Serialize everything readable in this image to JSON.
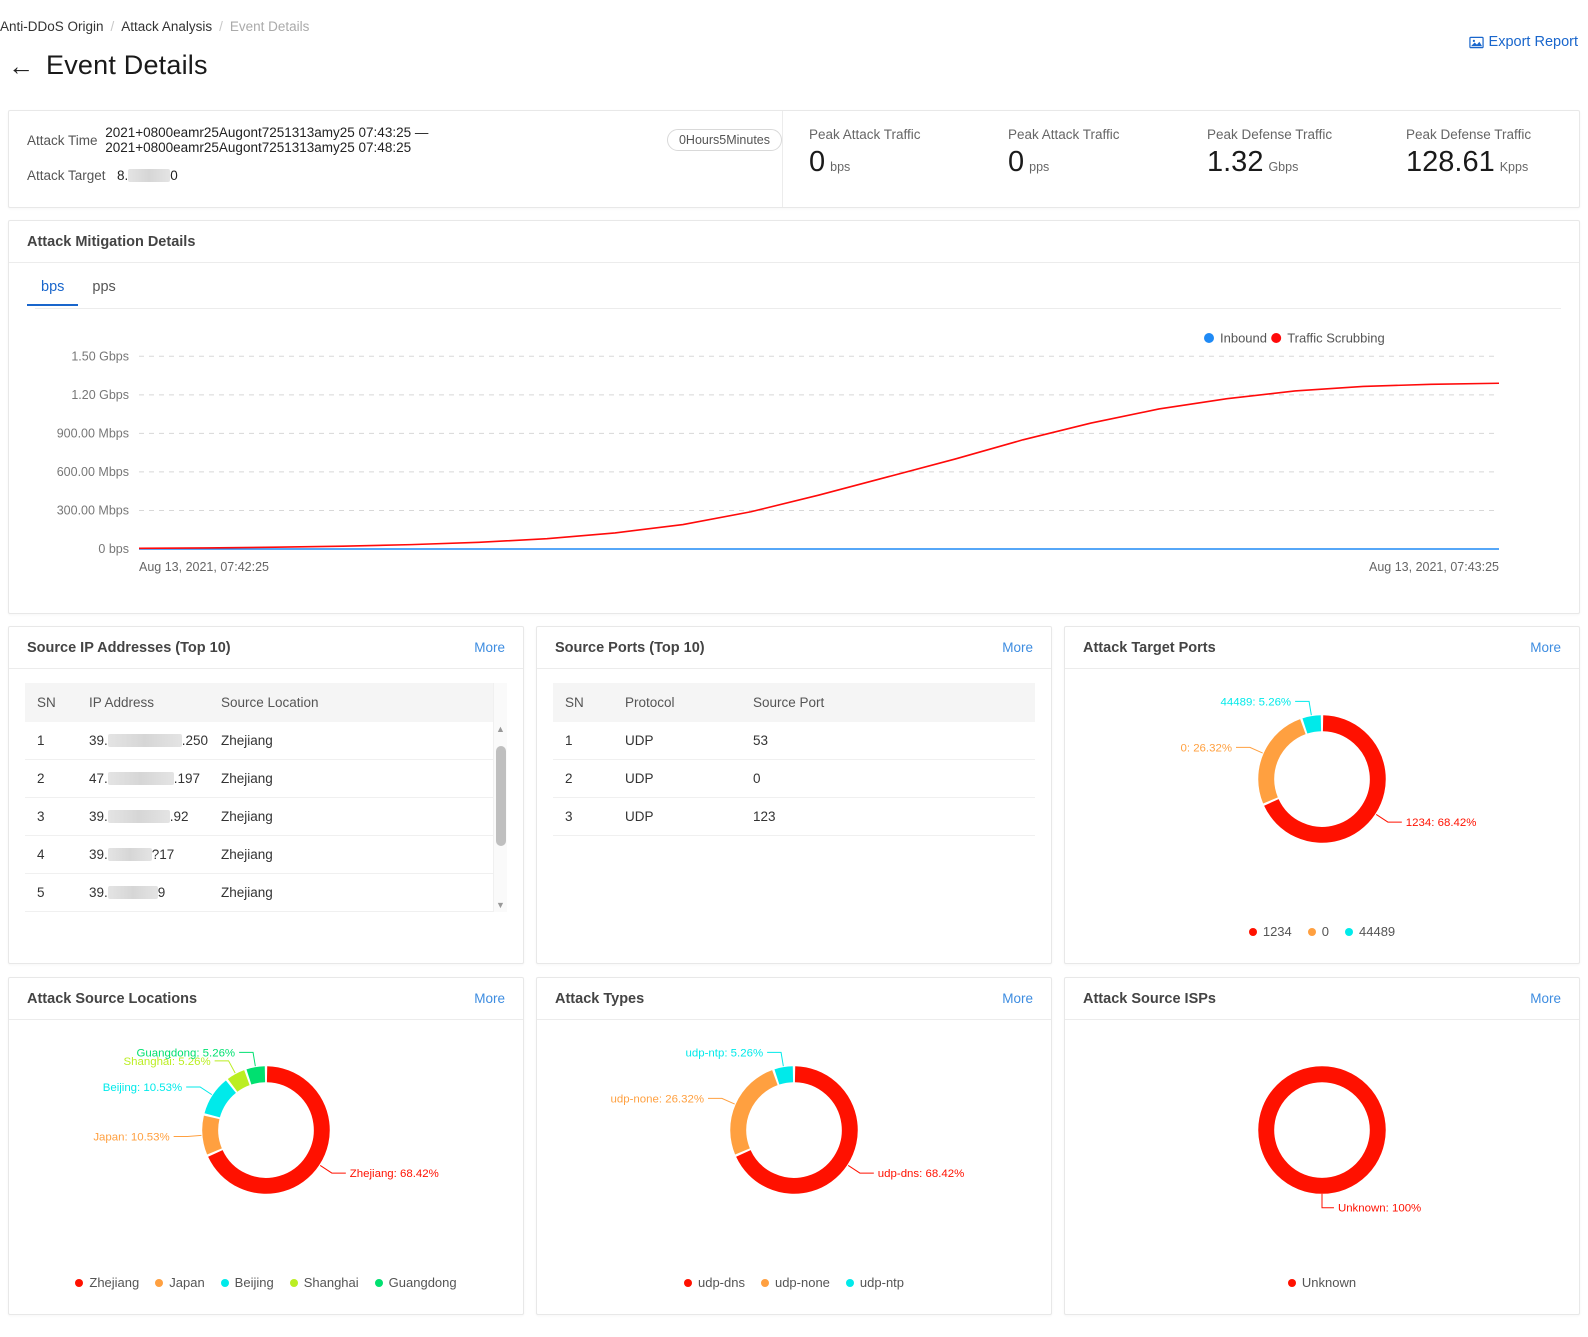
{
  "breadcrumb": {
    "items": [
      "Anti-DDoS Origin",
      "Attack Analysis",
      "Event Details"
    ],
    "sep": "/"
  },
  "export": {
    "label": "Export Report",
    "icon": "image-icon"
  },
  "header": {
    "title": "Event Details",
    "back_icon": "arrow-left-icon"
  },
  "summary": {
    "attack_time_label": "Attack Time",
    "attack_time_value": "2021+0800eamr25Augont7251313amy25 07:43:25 — 2021+0800eamr25Augont7251313amy25 07:48:25",
    "duration_pill": "0Hours5Minutes",
    "attack_target_label": "Attack Target",
    "attack_target_prefix": "8.",
    "attack_target_suffix": "0",
    "metrics": [
      {
        "label": "Peak Attack Traffic",
        "value": "0",
        "unit": "bps"
      },
      {
        "label": "Peak Attack Traffic",
        "value": "0",
        "unit": "pps"
      },
      {
        "label": "Peak Defense Traffic",
        "value": "1.32",
        "unit": "Gbps"
      },
      {
        "label": "Peak Defense Traffic",
        "value": "128.61",
        "unit": "Kpps"
      }
    ]
  },
  "mitigation": {
    "title": "Attack Mitigation Details",
    "tabs": [
      {
        "label": "bps",
        "active": true
      },
      {
        "label": "pps",
        "active": false
      }
    ]
  },
  "chart_data": {
    "type": "line",
    "title": "Attack Mitigation Details",
    "xlabel": "",
    "ylabel": "",
    "grid": true,
    "legend_position": "top-right",
    "ytick_labels": [
      "1.50 Gbps",
      "1.20 Gbps",
      "900.00 Mbps",
      "600.00 Mbps",
      "300.00 Mbps",
      "0 bps"
    ],
    "ytick_values": [
      1500,
      1200,
      900,
      600,
      300,
      0
    ],
    "ylim": [
      0,
      1650
    ],
    "yunit": "Mbps",
    "xtick_labels": [
      "Aug 13, 2021, 07:42:25",
      "Aug 13, 2021, 07:43:25"
    ],
    "series": [
      {
        "name": "Inbound",
        "color": "#1f8af5",
        "values": [
          0,
          0,
          0,
          0,
          0,
          0,
          0,
          0,
          0,
          0,
          0,
          0,
          0,
          0,
          0,
          0,
          0,
          0,
          0,
          0,
          0
        ]
      },
      {
        "name": "Traffic Scrubbing",
        "color": "#ff0a0a",
        "values": [
          5,
          8,
          14,
          22,
          34,
          52,
          80,
          125,
          190,
          290,
          420,
          560,
          700,
          850,
          980,
          1090,
          1170,
          1230,
          1265,
          1282,
          1290
        ]
      }
    ]
  },
  "cards": {
    "source_ips": {
      "title": "Source IP Addresses (Top 10)",
      "more": "More",
      "columns": [
        "SN",
        "IP Address",
        "Source Location"
      ],
      "rows": [
        {
          "sn": "1",
          "ip_prefix": "39.",
          "ip_suffix": ".250",
          "location": "Zhejiang"
        },
        {
          "sn": "2",
          "ip_prefix": "47.",
          "ip_suffix": ".197",
          "location": "Zhejiang"
        },
        {
          "sn": "3",
          "ip_prefix": "39.",
          "ip_suffix": ".92",
          "location": "Zhejiang"
        },
        {
          "sn": "4",
          "ip_prefix": "39.",
          "ip_suffix": "?17",
          "location": "Zhejiang"
        },
        {
          "sn": "5",
          "ip_prefix": "39.",
          "ip_suffix": "9",
          "location": "Zhejiang"
        }
      ]
    },
    "source_ports": {
      "title": "Source Ports (Top 10)",
      "more": "More",
      "columns": [
        "SN",
        "Protocol",
        "Source Port"
      ],
      "rows": [
        {
          "sn": "1",
          "protocol": "UDP",
          "port": "53"
        },
        {
          "sn": "2",
          "protocol": "UDP",
          "port": "0"
        },
        {
          "sn": "3",
          "protocol": "UDP",
          "port": "123"
        }
      ]
    },
    "attack_target_ports": {
      "title": "Attack Target Ports",
      "more": "More"
    },
    "attack_source_locations": {
      "title": "Attack Source Locations",
      "more": "More"
    },
    "attack_types": {
      "title": "Attack Types",
      "more": "More"
    },
    "attack_source_isps": {
      "title": "Attack Source ISPs",
      "more": "More"
    }
  },
  "donuts": {
    "attack_target_ports": {
      "type": "pie",
      "title": "Attack Target Ports",
      "labels": [
        "1234",
        "0",
        "44489"
      ],
      "values": [
        68.42,
        26.32,
        5.26
      ],
      "colors": [
        "#ff1100",
        "#ffa040",
        "#00eaea"
      ],
      "annotations": [
        "1234: 68.42%",
        "0: 26.32%",
        "44489: 5.26%"
      ]
    },
    "attack_source_locations": {
      "type": "pie",
      "title": "Attack Source Locations",
      "labels": [
        "Zhejiang",
        "Japan",
        "Beijing",
        "Shanghai",
        "Guangdong"
      ],
      "values": [
        68.42,
        10.53,
        10.53,
        5.26,
        5.26
      ],
      "colors": [
        "#ff1100",
        "#ffa040",
        "#00eaea",
        "#bbee22",
        "#00e070"
      ],
      "annotations": [
        "Zhejiang: 68.42%",
        "Japan: 10.53%",
        "Beijing: 10.53%",
        "Shanghai: 5.26%",
        "Guangdong: 5.26%"
      ]
    },
    "attack_types": {
      "type": "pie",
      "title": "Attack Types",
      "labels": [
        "udp-dns",
        "udp-none",
        "udp-ntp"
      ],
      "values": [
        68.42,
        26.32,
        5.26
      ],
      "colors": [
        "#ff1100",
        "#ffa040",
        "#00eaea"
      ],
      "annotations": [
        "udp-dns: 68.42%",
        "udp-none: 26.32%",
        "udp-ntp: 5.26%"
      ]
    },
    "attack_source_isps": {
      "type": "pie",
      "title": "Attack Source ISPs",
      "labels": [
        "Unknown"
      ],
      "values": [
        100
      ],
      "colors": [
        "#ff1100"
      ],
      "annotations": [
        "Unknown: 100%"
      ]
    }
  }
}
